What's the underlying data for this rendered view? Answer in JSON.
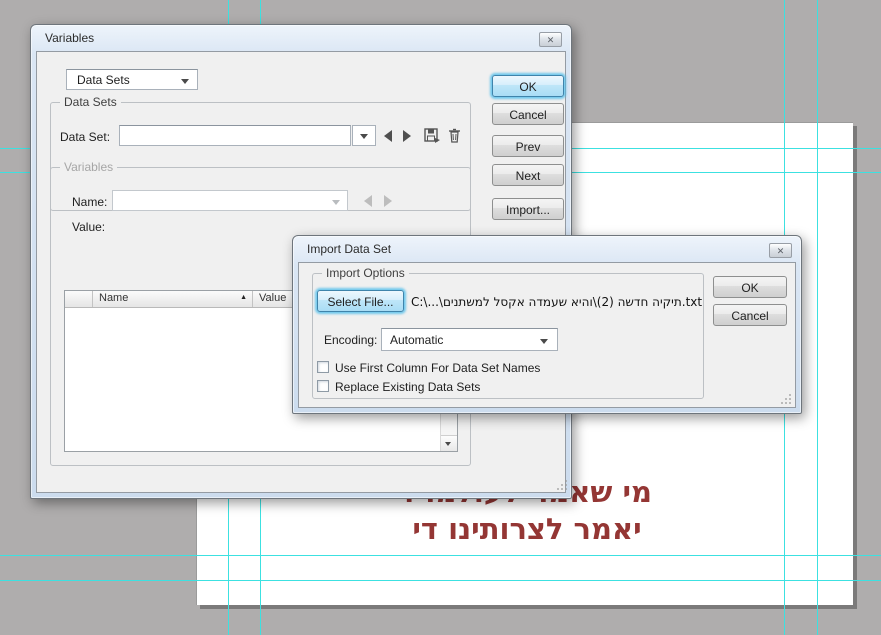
{
  "canvas": {
    "pasteboard_color": "#afadad",
    "page_color": "#ffffff",
    "guide_color": "#3ce1e1",
    "text_color": "#943634",
    "text_lines": [
      "מי שאמר לעולמו די",
      "יאמר לצרותינו די"
    ]
  },
  "icons": {
    "close": "✕",
    "sort_asc": "▲"
  },
  "variables_dialog": {
    "title": "Variables",
    "pulldown_value": "Data Sets",
    "data_sets_group": {
      "label": "Data Sets",
      "data_set_label": "Data Set:",
      "field_value": ""
    },
    "variables_group": {
      "label": "Variables",
      "name_label": "Name:",
      "name_field_value": "",
      "value_label": "Value:"
    },
    "table": {
      "columns": [
        "",
        "Name",
        "Value"
      ],
      "rows": []
    },
    "buttons": [
      "OK",
      "Cancel",
      "Prev",
      "Next",
      "Import..."
    ]
  },
  "import_dialog": {
    "title": "Import Data Set",
    "group_label": "Import Options",
    "select_file_label": "Select File...",
    "file_path": "C:\\...\\תיקיה חדשה (2)\\והיא שעמדה אקסל למשתנים.txt",
    "encoding_label": "Encoding:",
    "encoding_value": "Automatic",
    "checkboxes": [
      {
        "label": "Use First Column For Data Set Names",
        "checked": false
      },
      {
        "label": "Replace Existing Data Sets",
        "checked": false
      }
    ],
    "ok_label": "OK",
    "cancel_label": "Cancel"
  }
}
